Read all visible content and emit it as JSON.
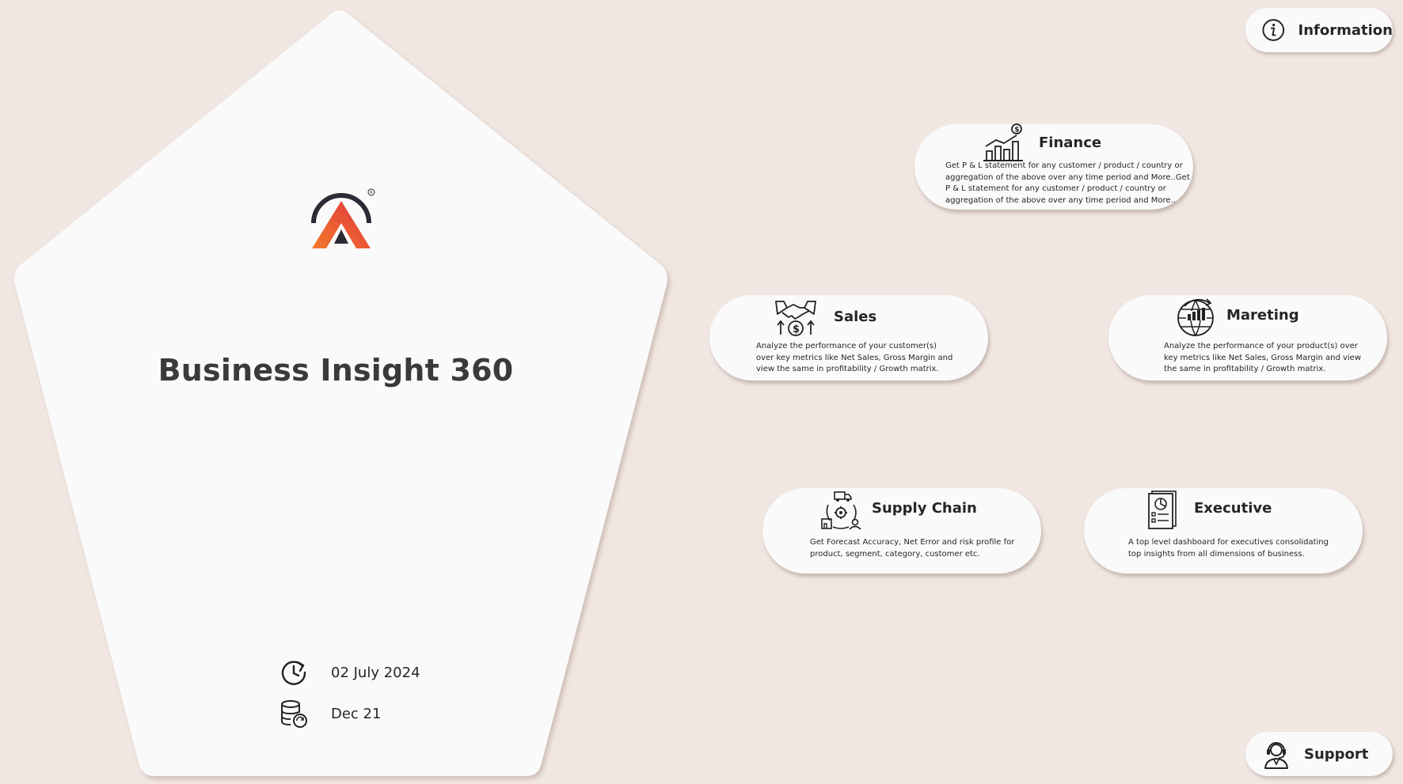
{
  "app": {
    "title": "Business Insight 360",
    "last_refresh_date": "02 July 2024",
    "data_period": "Dec 21",
    "logo_icon": "brand-logo-icon",
    "logo_colors": {
      "ring": "#2a2a35",
      "left": "#f06a30",
      "right": "#e23b46"
    }
  },
  "header": {
    "information_label": "Information",
    "information_icon": "info-icon"
  },
  "footer": {
    "support_label": "Support",
    "support_icon": "support-agent-icon"
  },
  "modules": {
    "finance": {
      "title": "Finance",
      "icon": "finance-chart-icon",
      "description": "Get P & L statement for any customer / product / country or aggregation of the above over any time period and More..Get P & L statement for any customer / product / country or aggregation of the above over any time period and More.."
    },
    "sales": {
      "title": "Sales",
      "icon": "handshake-dollar-icon",
      "description": "Analyze the performance of your customer(s) over key metrics like Net Sales, Gross Margin and view the same in profitability / Growth matrix."
    },
    "marketing": {
      "title": "Mareting",
      "icon": "globe-growth-icon",
      "description": "Analyze the performance of your product(s) over key metrics like Net Sales, Gross Margin and view the same in profitability / Growth matrix."
    },
    "supply_chain": {
      "title": "Supply Chain",
      "icon": "supply-chain-icon",
      "description": "Get Forecast Accuracy, Net Error and risk profile for product, segment, category, customer etc."
    },
    "executive": {
      "title": "Executive",
      "icon": "executive-report-icon",
      "description": "A top level dashboard for executives consolidating top insights from all dimensions of business."
    }
  },
  "colors": {
    "background": "#f1e7e2",
    "panel": "#fafafa",
    "text": "#262626"
  }
}
